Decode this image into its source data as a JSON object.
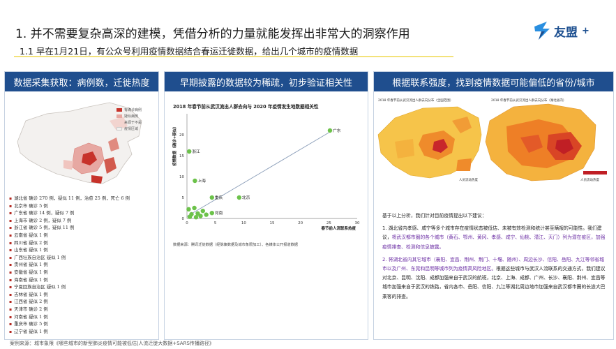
{
  "header": {
    "title": "1. 并不需要复杂高深的建模，凭借分析的力量就能发挥出非常大的洞察作用",
    "subtitle": "1.1 早在1月21日，有公众号利用疫情数据结合春运迁徙数据，给出几个城市的疫情数据",
    "brand": "友盟",
    "brand_plus": "+",
    "accent": "#1f4e8e",
    "highlight": "#f3e27a"
  },
  "panel1": {
    "heading": "数据采集获取：病例数，迁徙热度",
    "legend": [
      "有确诊病例",
      "疑似病例",
      "来源于不是",
      "疫情区域"
    ],
    "stats": [
      "湖北省 确诊 270 例，疑似 11 例，治愈 25 例，死亡 6 例",
      "北京市 确诊 5 例",
      "广东省 确诊 14 例，疑似 7 例",
      "上海市 确诊 2 例，疑似 7 例",
      "浙江省 确诊 5 例，疑似 11 例",
      "云南省 疑似 1 例",
      "四川省 疑似 2 例",
      "山东省 疑似 1 例",
      "广西壮族自治区 疑似 1 例",
      "贵州省 疑似 1 例",
      "安徽省 疑似 1 例",
      "海南省 疑似 1 例",
      "宁夏回族自治区 疑似 1 例",
      "吉林省 疑似 1 例",
      "江西省 疑似 2 例",
      "天津市 确诊 2 例",
      "河南省 疑似 1 例",
      "重庆市 确诊 5 例",
      "辽宁省 疑似 1 例"
    ]
  },
  "panel2": {
    "heading": "早期披露的数据较为稀疏，初步验证相关性",
    "source": "数据来源：腾讯迁徙数据（经脉策数据及城市象限加工）、各媒体公开报道数据"
  },
  "panel3": {
    "heading": "根据联系强度，找到疫情数据可能偏低的省份/城市",
    "map_left_title": "2018 年春节前从武汉流出人群去向分布（全国范围）",
    "map_right_title": "2018 年春节前从武汉流出人群去向分布（湖北省内）",
    "map_legend_label": "人员流动热度",
    "intro": "基于以上分析，我们针对目前疫情提出以下建议：",
    "advice1_plain": "1. 湖北省内孝感、咸宁等多个城市存在疫情状态被低估、未被有效检测和统计甚至瞒报的可能性。我们建议，",
    "advice1_emph": "将武汉都市圈的各个城市（黄石、鄂州、黄冈、孝感、咸宁、仙桃、潜江、天门）列为潜在疫区，加强疫情排查、检测和信息披露。",
    "advice2_emph": "2. 将湖北省内其它城市（襄阳、宜昌、荆州、荆门、十堰、随州）、周边长沙、信阳、岳阳、九江等邻省城市以及广州、东莞和昆明等城市列为疫情高风险地区。",
    "advice2_plain": "根据这些城市与武汉人流联系的交通方式，我们建议对北京、昆明、沈阳、成都加强来自于武汉的航班，北京、上海、成都、广州、长沙、襄阳、荆州、宜昌等城市加强来自于武汉的铁路，省内各市、岳阳、信阳、九江等湖北周边地市加强来自武汉都市圈的长途大巴乘客的排查。"
  },
  "footer": {
    "source": "案例来源：城市象限《哪些城市的新型肺炎疫情可能被低估|人流迁徙大数据+SARS传播路径》"
  },
  "chart_data": {
    "type": "scatter",
    "title": "2018 年春节前从武汉流出人群去向与 2020 年疫情发生地数据相关性",
    "xlabel": "春节前人流联系热度",
    "ylabel": "疫情数据（确诊+疑似）",
    "xlim": [
      0,
      30
    ],
    "ylim": [
      0,
      25
    ],
    "xticks": [
      0,
      5,
      10,
      15,
      20,
      25,
      30
    ],
    "yticks": [
      0,
      5,
      10,
      15,
      20
    ],
    "grid": false,
    "trendline": [
      [
        0,
        0.5
      ],
      [
        25,
        20.5
      ]
    ],
    "points": [
      {
        "x": 25.2,
        "y": 21,
        "label": "广东"
      },
      {
        "x": 0.4,
        "y": 16,
        "label": "浙江"
      },
      {
        "x": 1.4,
        "y": 9,
        "label": "上海"
      },
      {
        "x": 4.4,
        "y": 5,
        "label": "重庆"
      },
      {
        "x": 9.2,
        "y": 5,
        "label": "北京"
      },
      {
        "x": 4.4,
        "y": 1.3,
        "label": "河南"
      },
      {
        "x": 0.3,
        "y": 2.2,
        "label": ""
      },
      {
        "x": 0.8,
        "y": 1.0,
        "label": ""
      },
      {
        "x": 1.3,
        "y": 2.5,
        "label": ""
      },
      {
        "x": 1.9,
        "y": 1.2,
        "label": ""
      },
      {
        "x": 2.4,
        "y": 0.6,
        "label": ""
      },
      {
        "x": 2.8,
        "y": 1.8,
        "label": ""
      },
      {
        "x": 3.4,
        "y": 0.9,
        "label": ""
      },
      {
        "x": 0.5,
        "y": 0.4,
        "label": ""
      },
      {
        "x": 1.6,
        "y": 0.3,
        "label": ""
      }
    ],
    "point_color": "#6cc24a",
    "line_color": "#8a9db8"
  }
}
